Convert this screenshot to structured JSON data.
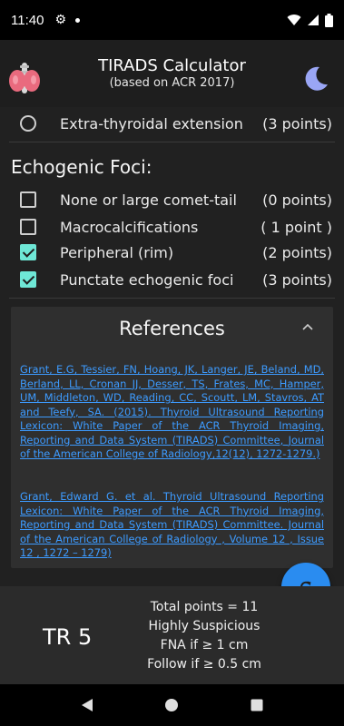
{
  "status_bar": {
    "time": "11:40"
  },
  "app_bar": {
    "title": "TIRADS Calculator",
    "subtitle": "(based on ACR 2017)"
  },
  "options": {
    "extra_thyroidal": {
      "label": "Extra-thyroidal extension",
      "points": "(3 points)"
    }
  },
  "echogenic_foci": {
    "title": "Echogenic Foci:",
    "items": [
      {
        "label": "None or large comet-tail",
        "points": "(0 points)",
        "checked": false
      },
      {
        "label": "Macrocalcifications",
        "points": "( 1 point )",
        "checked": false
      },
      {
        "label": "Peripheral (rim)",
        "points": "(2 points)",
        "checked": true
      },
      {
        "label": "Punctate echogenic foci",
        "points": "(3 points)",
        "checked": true
      }
    ]
  },
  "references": {
    "title": "References",
    "items": [
      "Grant, E.G, Tessier, FN, Hoang, JK, Langer, JE, Beland, MD, Berland, LL, Cronan JJ, Desser, TS, Frates, MC, Hamper, UM, Middleton, WD, Reading, CC, Scoutt, LM, Stavros, AT and Teefy, SA. (2015). Thyroid Ultrasound Reporting Lexicon: White Paper of the ACR Thyroid Imaging, Reporting and Data System (TIRADS) Committee, Journal of the American College of Radiology,12(12), 1272-1279.)",
      "Grant, Edward G. et al. Thyroid Ultrasound Reporting Lexicon: White Paper of the ACR Thyroid Imaging, Reporting and Data System (TIRADS) Committee. Journal of the American College of Radiology , Volume 12 , Issue 12 , 1272 – 1279)"
    ]
  },
  "result": {
    "level": "TR 5",
    "total": "Total points = 11",
    "risk": "Highly Suspicious",
    "fna": "FNA if ≥ 1 cm",
    "follow": "Follow if ≥ 0.5 cm"
  },
  "colors": {
    "accent": "#2a8cf0",
    "check": "#6ee7d6",
    "link": "#3d9bff"
  }
}
